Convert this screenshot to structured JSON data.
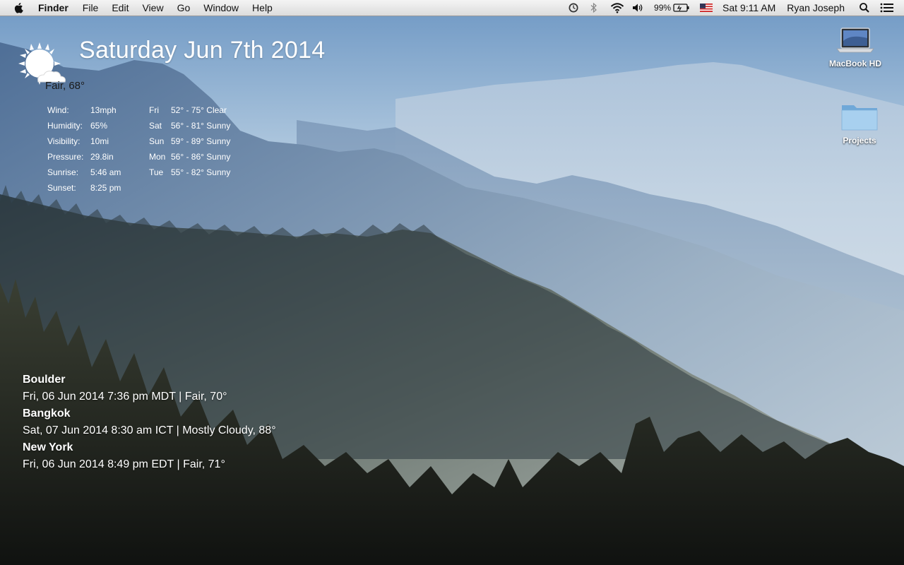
{
  "menubar": {
    "app_name": "Finder",
    "menus": [
      "File",
      "Edit",
      "View",
      "Go",
      "Window",
      "Help"
    ],
    "battery_percent": "99%",
    "clock": "Sat 9:11 AM",
    "user": "Ryan Joseph",
    "status_icons": [
      "time-machine-icon",
      "bluetooth-icon",
      "wifi-icon",
      "volume-icon",
      "battery-icon",
      "us-flag-icon",
      "spotlight-icon",
      "notification-center-icon"
    ]
  },
  "desktop": {
    "icons": [
      {
        "label": "MacBook HD",
        "icon": "hard-drive-icon"
      },
      {
        "label": "Projects",
        "icon": "folder-icon"
      }
    ]
  },
  "weather": {
    "date_title": "Saturday Jun 7th 2014",
    "condition": "Fair, 68°",
    "icon": "partly-sunny-icon",
    "details": [
      {
        "label": "Wind:",
        "value": "13mph"
      },
      {
        "label": "Humidity:",
        "value": "65%"
      },
      {
        "label": "Visibility:",
        "value": "10mi"
      },
      {
        "label": "Pressure:",
        "value": "29.8in"
      },
      {
        "label": "Sunrise:",
        "value": "5:46 am"
      },
      {
        "label": "Sunset:",
        "value": "8:25 pm"
      }
    ],
    "forecast": [
      {
        "day": "Fri",
        "text": "52° - 75° Clear"
      },
      {
        "day": "Sat",
        "text": "56° - 81° Sunny"
      },
      {
        "day": "Sun",
        "text": "59° - 89° Sunny"
      },
      {
        "day": "Mon",
        "text": "56° - 86° Sunny"
      },
      {
        "day": "Tue",
        "text": "55° - 82° Sunny"
      }
    ]
  },
  "world_clock": [
    {
      "city": "Boulder",
      "line": "Fri, 06 Jun 2014 7:36 pm MDT | Fair, 70°"
    },
    {
      "city": "Bangkok",
      "line": "Sat, 07 Jun 2014 8:30 am ICT | Mostly Cloudy, 88°"
    },
    {
      "city": "New York",
      "line": "Fri, 06 Jun 2014 8:49 pm EDT | Fair, 71°"
    }
  ]
}
